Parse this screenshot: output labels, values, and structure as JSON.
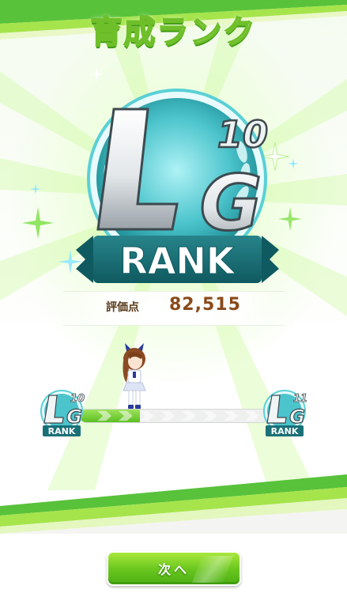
{
  "screen": {
    "title": "育成ランク"
  },
  "rank": {
    "current": {
      "letters": "LG",
      "level": "10",
      "label": "RANK"
    },
    "next": {
      "letters": "LG",
      "level": "11",
      "label": "RANK"
    },
    "progress_fraction": 0.32
  },
  "score": {
    "label": "評価点",
    "value": "82,515"
  },
  "buttons": {
    "next_label": "次へ"
  },
  "colors": {
    "accent_green": "#6cc81f",
    "badge_teal": "#1f8f93",
    "score_brown": "#8a4a1a"
  }
}
